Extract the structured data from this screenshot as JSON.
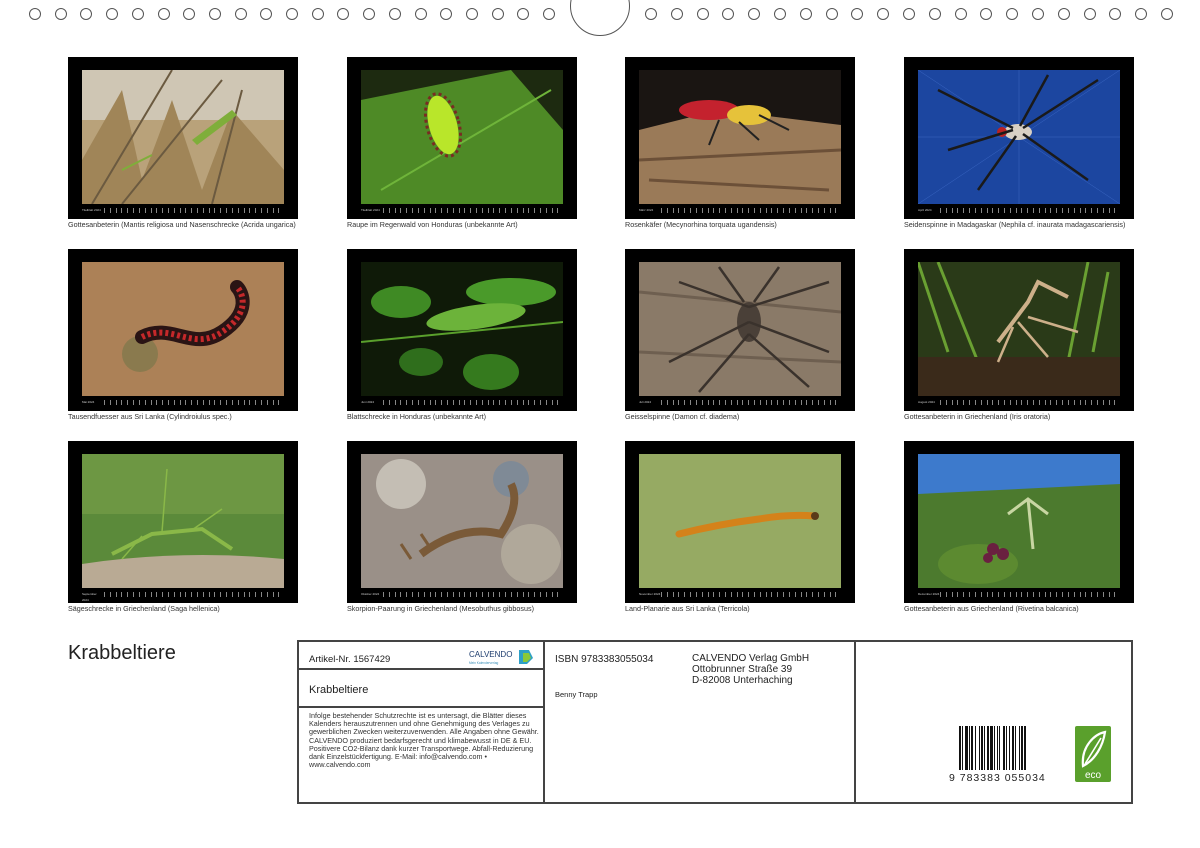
{
  "title": "Krabbeltiere",
  "thumbnails": [
    {
      "caption": "Gottesanbeterin (Mantis religiosa und Nasenschrecke (Acrida ungarica)",
      "month": "Titelblatt 2024"
    },
    {
      "caption": "Raupe im Regenwald von Honduras (unbekannte Art)",
      "month": "Titelblatt 2024"
    },
    {
      "caption": "Rosenkäfer (Mecynorhina torquata ugandensis)",
      "month": "März 2024"
    },
    {
      "caption": "Seidenspinne in Madagaskar (Nephila cf. inaurata madagascariensis)",
      "month": "April 2024"
    },
    {
      "caption": "Tausendfuesser aus Sri Lanka (Cylindroiulus spec.)",
      "month": "Mai 2024"
    },
    {
      "caption": "Blattschrecke in Honduras (unbekannte Art)",
      "month": "Juni 2024"
    },
    {
      "caption": "Geisselspinne (Damon cf. diadema)",
      "month": "Juli 2024"
    },
    {
      "caption": "Gottesanbeterin in Griechenland (Iris oratoria)",
      "month": "August 2024"
    },
    {
      "caption": "Sägeschrecke in Griechenland (Saga hellenica)",
      "month": "September 2024"
    },
    {
      "caption": "Skorpion-Paarung in Griechenland (Mesobuthus gibbosus)",
      "month": "Oktober 2024"
    },
    {
      "caption": "Land-Planarie aus Sri Lanka (Terricola)",
      "month": "November 2024"
    },
    {
      "caption": "Gottesanbeterin aus Griechenland (Rivetina balcanica)",
      "month": "Dezember 2024"
    }
  ],
  "info": {
    "article": "Artikel-Nr. 1567429",
    "brand": "CALVENDO",
    "brand_tagline": "Mein Kalenderverlag",
    "product_title": "Krabbeltiere",
    "legal_text": "Infolge bestehender Schutzrechte ist es untersagt, die Blätter dieses Kalenders herauszutrennen und ohne Genehmigung des Verlages zu gewerblichen Zwecken weiterzuverwenden. Alle Angaben ohne Gewähr. CALVENDO produziert bedarfsgerecht und klimabewusst in DE & EU. Positivere CO2-Bilanz dank kurzer Transportwege. Abfall-Reduzierung dank Einzelstückfertigung. E-Mail: info@calvendo.com • www.calvendo.com",
    "isbn": "ISBN 9783383055034",
    "author": "Benny Trapp",
    "publisher_line1": "CALVENDO Verlag GmbH",
    "publisher_line2": "Ottobrunner Straße 39",
    "publisher_line3": "D-82008 Unterhaching",
    "barcode_number": "9 783383 055034",
    "eco_label": "eco"
  },
  "colors": {
    "frame": "#000000",
    "border": "#444444",
    "eco_green": "#5aa02c"
  }
}
